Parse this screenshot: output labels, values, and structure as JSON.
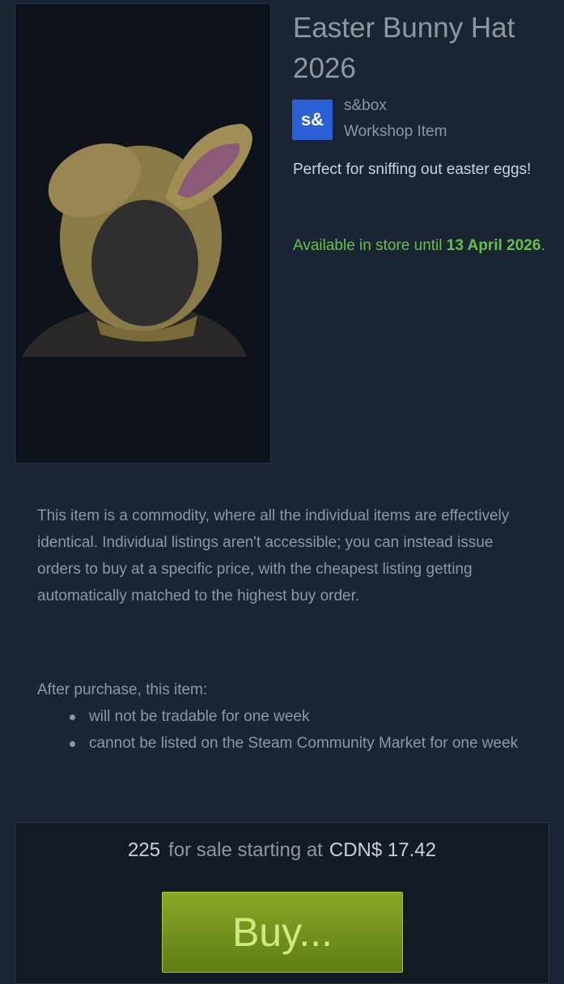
{
  "item": {
    "title": "Easter Bunny Hat 2026",
    "game": {
      "icon_text": "s&",
      "name": "s&box"
    },
    "type": "Workshop Item",
    "description": "Perfect for sniffing out easter eggs!",
    "availability": {
      "prefix": "Available in store until ",
      "date": "13 April 2026",
      "suffix": "."
    }
  },
  "commodity_info": "This item is a commodity, where all the individual items are effectively identical. Individual listings aren't accessible; you can instead issue orders to buy at a specific price, with the cheapest listing getting automatically matched to the highest buy order.",
  "after_purchase": {
    "heading": "After purchase, this item:",
    "restrictions": [
      "will not be tradable for one week",
      "cannot be listed on the Steam Community Market for one week"
    ]
  },
  "sale": {
    "count": "225",
    "text": "for sale starting at",
    "price": "CDN$ 17.42",
    "buy_label": "Buy..."
  },
  "colors": {
    "background": "#1b2433",
    "availability_green": "#66c04a",
    "buy_button": "#7a9a1f",
    "game_icon": "#2a5fd6"
  }
}
